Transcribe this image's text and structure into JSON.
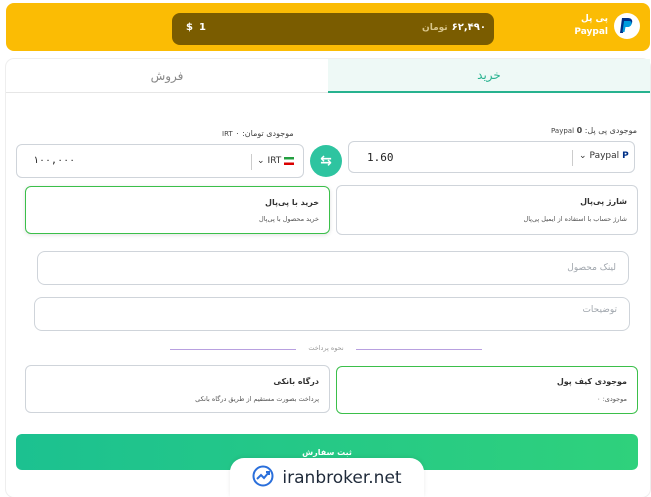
{
  "topbar": {
    "rate_right_value": "۶۲,۴۹۰",
    "rate_right_unit": "تومان",
    "rate_left_value": "1",
    "rate_left_currency": "$",
    "brand_name": "پی پل",
    "brand_sub": "Paypal"
  },
  "tabs": [
    {
      "label": "خرید",
      "active": true
    },
    {
      "label": "فروش",
      "active": false
    }
  ],
  "paypal_balance": {
    "label": "موجودی پی پل:",
    "value": "0",
    "unit": "Paypal"
  },
  "toman_balance": {
    "label": "موجودی تومان: ۰",
    "unit": "IRT"
  },
  "amount_paypal": "1.60",
  "currency_paypal": "Paypal",
  "amount_irt": "۱۰۰,۰۰۰",
  "currency_irt": "IRT",
  "options": {
    "charge": {
      "title": "شارژ پی‌پال",
      "desc": "شارژ حساب با استفاده از ایمیل پی‌پال"
    },
    "buy": {
      "title": "خرید با پی‌پال",
      "desc": "خرید محصول با پی‌پال"
    }
  },
  "fields": {
    "product_link_placeholder": "لینک محصول",
    "notes_placeholder": "توضیحات"
  },
  "payment": {
    "divider": "نحوه پرداخت",
    "wallet": {
      "title": "موجودی کیف پول",
      "desc": "موجودی: ۰"
    },
    "gateway": {
      "title": "درگاه بانکی",
      "desc": "پرداخت بصورت مستقیم از طریق درگاه بانکی"
    }
  },
  "submit_label": "ثبت سفارش",
  "watermark": "iranbroker.net",
  "colors": {
    "topbar": "#fbbc04",
    "pill": "#7a5c00",
    "accent": "#27b28f",
    "selected_border": "#3bbf4a"
  }
}
